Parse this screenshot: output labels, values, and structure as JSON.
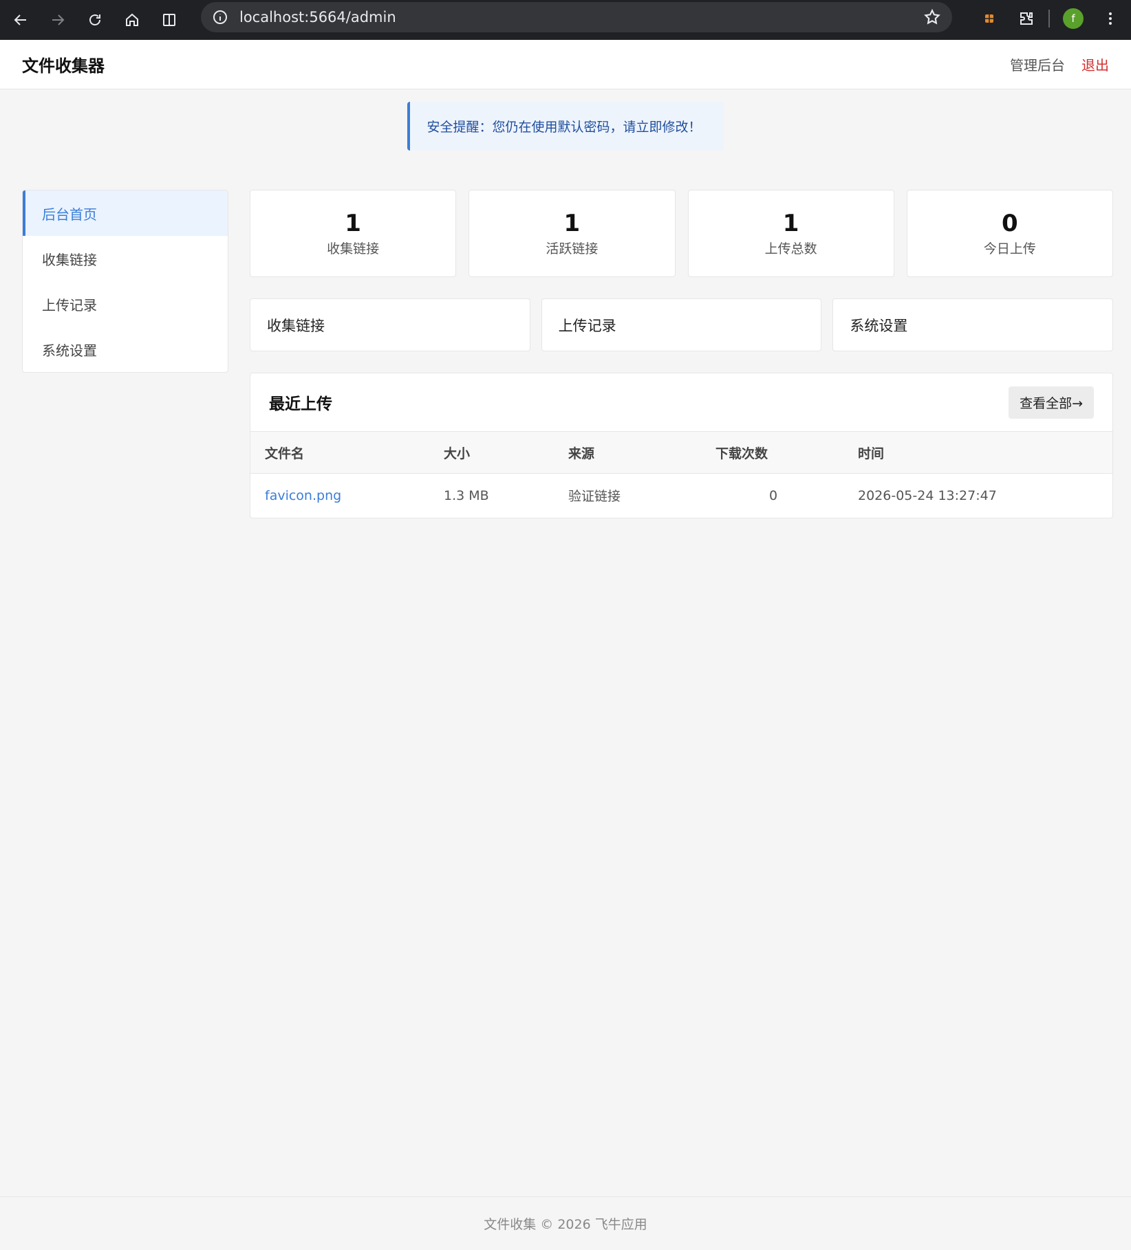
{
  "browser": {
    "url": "localhost:5664/admin",
    "avatar_letter": "f"
  },
  "header": {
    "brand": "文件收集器",
    "admin_link": "管理后台",
    "logout_link": "退出"
  },
  "alert": {
    "text": "安全提醒：您仍在使用默认密码，请立即修改！"
  },
  "sidebar": {
    "items": [
      {
        "label": "后台首页",
        "active": true
      },
      {
        "label": "收集链接"
      },
      {
        "label": "上传记录"
      },
      {
        "label": "系统设置"
      }
    ]
  },
  "stats": [
    {
      "value": "1",
      "label": "收集链接"
    },
    {
      "value": "1",
      "label": "活跃链接"
    },
    {
      "value": "1",
      "label": "上传总数"
    },
    {
      "value": "0",
      "label": "今日上传"
    }
  ],
  "quick_links": [
    "收集链接",
    "上传记录",
    "系统设置"
  ],
  "recent": {
    "title": "最近上传",
    "view_all": "查看全部→",
    "columns": [
      "文件名",
      "大小",
      "来源",
      "下载次数",
      "时间"
    ],
    "rows": [
      {
        "filename": "favicon.png",
        "size": "1.3 MB",
        "source": "验证链接",
        "downloads": "0",
        "time": "2026-05-24 13:27:47"
      }
    ]
  },
  "footer": {
    "text": "文件收集 © 2026 飞牛应用"
  },
  "colors": {
    "accent": "#3b7dd8",
    "danger": "#d32f2f"
  }
}
